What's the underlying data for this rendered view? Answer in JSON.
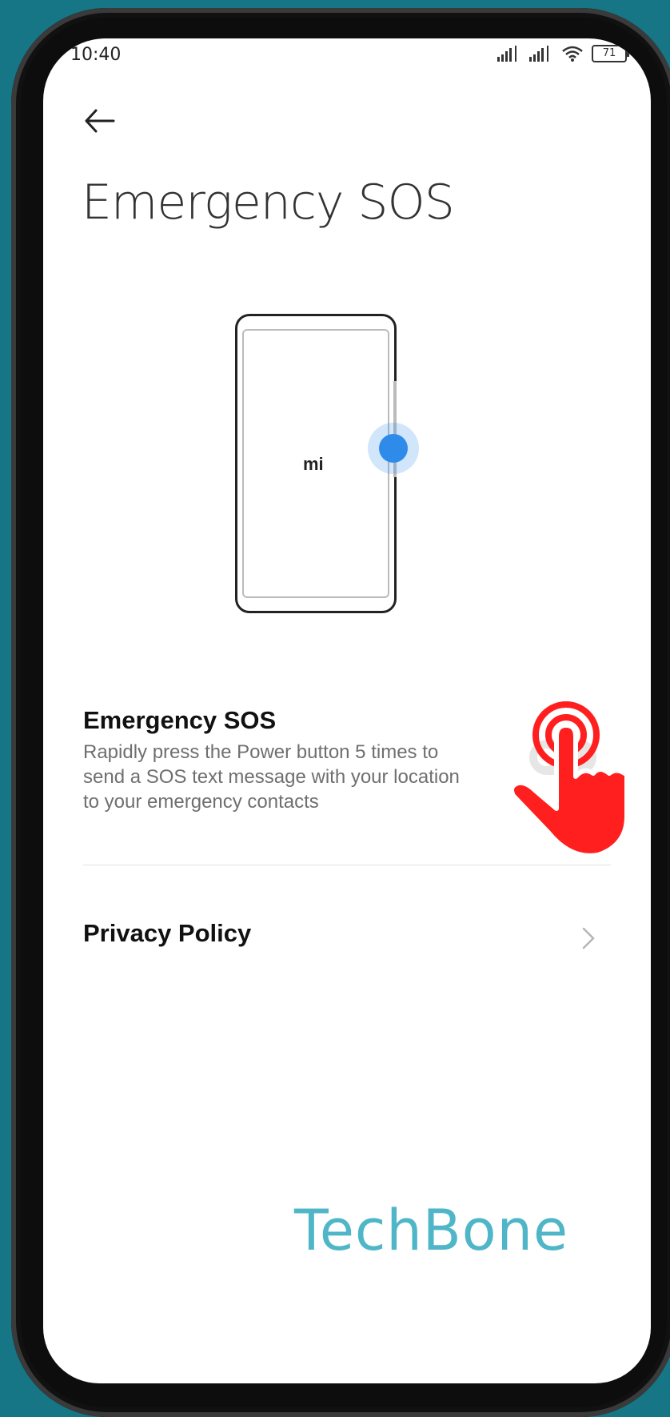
{
  "status_bar": {
    "time": "10:40",
    "battery": "71"
  },
  "header": {
    "title": "Emergency SOS"
  },
  "illustration": {
    "logo": "mi"
  },
  "sos_setting": {
    "title": "Emergency SOS",
    "description": "Rapidly press the Power button 5 times to send a SOS text message with your location to your emergency contacts",
    "enabled": false
  },
  "privacy": {
    "label": "Privacy Policy"
  },
  "watermark": "TechBone",
  "colors": {
    "background": "#167686",
    "accent": "#2f8bea",
    "hand": "#ff1f1f",
    "watermark": "#4fb6c8"
  }
}
